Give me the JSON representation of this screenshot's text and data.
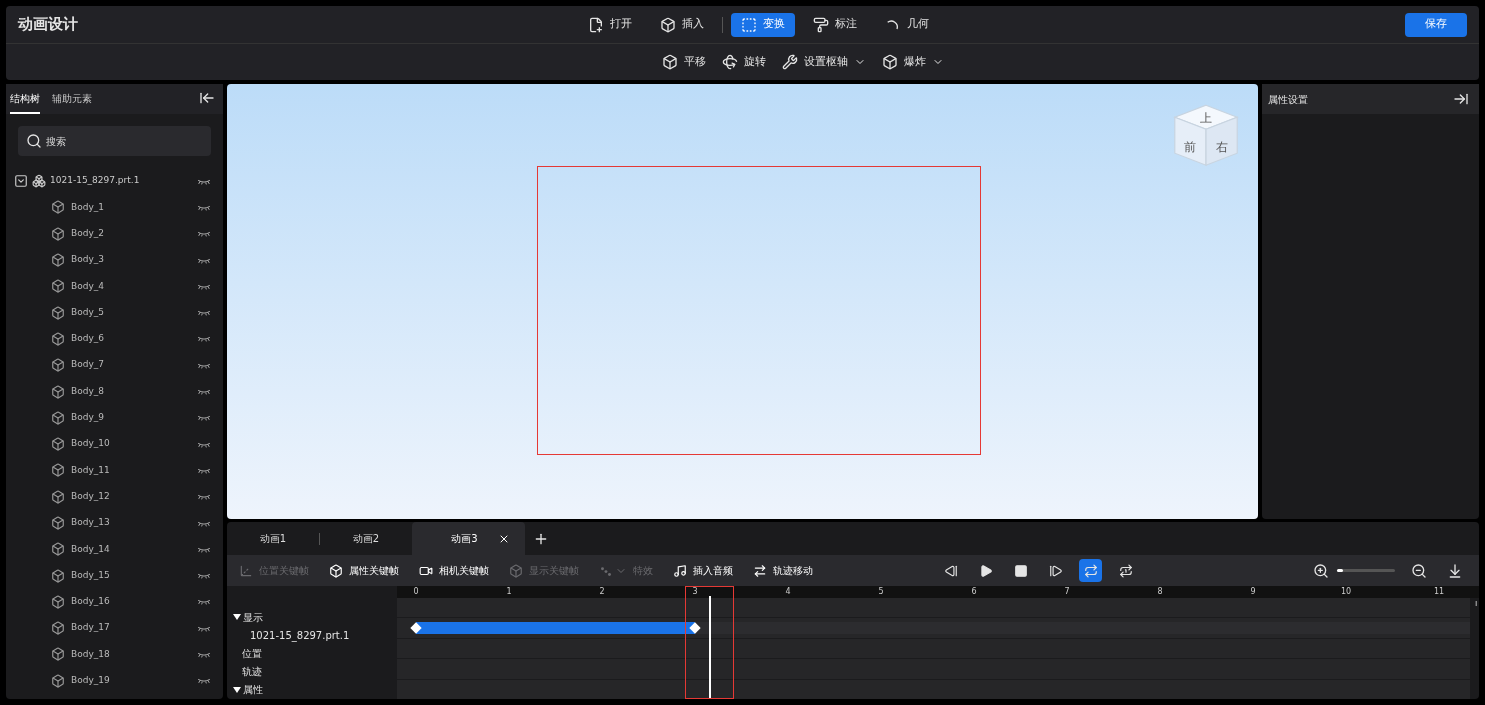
{
  "window": {
    "title": "动画设计"
  },
  "main_toolbar": [
    {
      "label": "打开",
      "selected": false
    },
    {
      "label": "插入",
      "selected": false
    },
    {
      "label": "变换",
      "selected": true
    },
    {
      "label": "标注",
      "selected": false
    },
    {
      "label": "几何",
      "selected": false
    }
  ],
  "save_button": "保存",
  "transform_toolbar": [
    {
      "label": "平移",
      "dropdown": false
    },
    {
      "label": "旋转",
      "dropdown": false
    },
    {
      "label": "设置枢轴",
      "dropdown": true
    },
    {
      "label": "爆炸",
      "dropdown": true
    }
  ],
  "sidebar": {
    "tabs": [
      {
        "label": "结构树",
        "selected": true
      },
      {
        "label": "辅助元素",
        "selected": false
      }
    ],
    "search": {
      "placeholder": "搜索"
    },
    "tree": [
      {
        "label": "1021-15_8297.prt.1",
        "expanded": true,
        "children": [
          {
            "label": "Body_1"
          },
          {
            "label": "Body_2"
          },
          {
            "label": "Body_3"
          },
          {
            "label": "Body_4"
          },
          {
            "label": "Body_5"
          },
          {
            "label": "Body_6"
          },
          {
            "label": "Body_7"
          },
          {
            "label": "Body_8"
          },
          {
            "label": "Body_9"
          },
          {
            "label": "Body_10"
          },
          {
            "label": "Body_11"
          },
          {
            "label": "Body_12"
          },
          {
            "label": "Body_13"
          },
          {
            "label": "Body_14"
          },
          {
            "label": "Body_15"
          },
          {
            "label": "Body_16"
          },
          {
            "label": "Body_17"
          },
          {
            "label": "Body_18"
          },
          {
            "label": "Body_19"
          }
        ]
      }
    ]
  },
  "view_cube": {
    "top": "上",
    "front": "前",
    "right": "右"
  },
  "properties_panel": {
    "title": "属性设置"
  },
  "animation_tabs": [
    {
      "label": "动画1",
      "selected": false
    },
    {
      "label": "动画2",
      "selected": false
    },
    {
      "label": "动画3",
      "selected": true
    }
  ],
  "timeline_toolbar": [
    {
      "label": "位置关键帧",
      "disabled": true
    },
    {
      "label": "属性关键帧",
      "disabled": false
    },
    {
      "label": "相机关键帧",
      "disabled": false
    },
    {
      "label": "显示关键帧",
      "disabled": true
    },
    {
      "label": "特效",
      "disabled": true
    },
    {
      "label": "插入音频",
      "disabled": false
    },
    {
      "label": "轨迹移动",
      "disabled": false
    }
  ],
  "playback": [
    {
      "kind": "step-back",
      "selected": false
    },
    {
      "kind": "play",
      "selected": false
    },
    {
      "kind": "stop",
      "selected": false
    },
    {
      "kind": "step-forward",
      "selected": false
    },
    {
      "kind": "loop",
      "selected": true
    },
    {
      "kind": "loop-once",
      "selected": false
    }
  ],
  "zoom_slider": {
    "level": 0.1
  },
  "timeline": {
    "ruler": [
      "0",
      "1",
      "2",
      "3",
      "4",
      "5",
      "6",
      "7",
      "8",
      "9",
      "10",
      "11"
    ],
    "playhead": {
      "level": 0.278
    },
    "tracks": [
      {
        "kind": "group",
        "label": "显示",
        "expanded": true
      },
      {
        "kind": "clip",
        "label": "1021-15_8297.prt.1",
        "level": 0.265
      },
      {
        "kind": "item",
        "label": "位置"
      },
      {
        "kind": "item",
        "label": "轨迹"
      },
      {
        "kind": "group",
        "label": "属性",
        "expanded": true
      }
    ]
  }
}
